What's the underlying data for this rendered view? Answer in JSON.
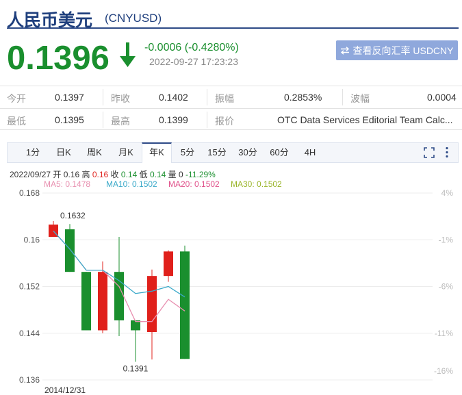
{
  "header": {
    "title": "人民币美元",
    "code": "(CNYUSD)"
  },
  "quote": {
    "price": "0.1396",
    "change": "-0.0006 (-0.4280%)",
    "time": "2022-09-27 17:23:23",
    "switch_label": "查看反向汇率 USDCNY",
    "colors": {
      "down": "#1a8f2e",
      "up": "#e0201b",
      "accent": "#2d4a86"
    }
  },
  "stats": [
    [
      {
        "label": "今开",
        "value": "0.1397"
      },
      {
        "label": "昨收",
        "value": "0.1402"
      },
      {
        "label": "振幅",
        "value": "0.2853%"
      },
      {
        "label": "波幅",
        "value": "0.0004"
      }
    ],
    [
      {
        "label": "最低",
        "value": "0.1395"
      },
      {
        "label": "最高",
        "value": "0.1399"
      },
      {
        "label": "报价",
        "value": "OTC Data Services Editorial Team Calc..."
      }
    ]
  ],
  "tabs": [
    "1分",
    "日K",
    "周K",
    "月K",
    "年K",
    "5分",
    "15分",
    "30分",
    "60分",
    "4H"
  ],
  "active_tab": "年K",
  "candle_info": {
    "date": "2022/09/27",
    "open_label": "开",
    "open": "0.16",
    "high_label": "高",
    "high": "0.16",
    "close_label": "收",
    "close": "0.14",
    "low_label": "低",
    "low": "0.14",
    "vol_label": "量",
    "vol": "0",
    "change": "-11.29%"
  },
  "ma": [
    {
      "label": "MA5: 0.1478",
      "color": "#e890b0"
    },
    {
      "label": "MA10: 0.1502",
      "color": "#3aa9c9"
    },
    {
      "label": "MA20: 0.1502",
      "color": "#e0508a"
    },
    {
      "label": "MA30: 0.1502",
      "color": "#9ab52a"
    }
  ],
  "chart_data": {
    "type": "candlestick",
    "ylim": [
      0.136,
      0.168
    ],
    "y_ticks": [
      "0.168",
      "0.16",
      "0.152",
      "0.144",
      "0.136"
    ],
    "y_tick_values": [
      0.168,
      0.16,
      0.152,
      0.144,
      0.136
    ],
    "right_ticks": [
      "4%",
      "-1%",
      "-6%",
      "-11%",
      "-16%"
    ],
    "right_tick_values": [
      0.168,
      0.16,
      0.152,
      0.144,
      0.1375
    ],
    "x_label": "2014/12/31",
    "grid": true,
    "candles": [
      {
        "open": 0.1605,
        "close": 0.1626,
        "high": 0.1632,
        "low": 0.1605
      },
      {
        "open": 0.1618,
        "close": 0.1545,
        "high": 0.1627,
        "low": 0.1545
      },
      {
        "open": 0.1545,
        "close": 0.1445,
        "high": 0.1545,
        "low": 0.1445
      },
      {
        "open": 0.1445,
        "close": 0.1545,
        "high": 0.1563,
        "low": 0.144
      },
      {
        "open": 0.1545,
        "close": 0.1462,
        "high": 0.1605,
        "low": 0.1435
      },
      {
        "open": 0.1462,
        "close": 0.1445,
        "high": 0.1462,
        "low": 0.1391
      },
      {
        "open": 0.1442,
        "close": 0.1538,
        "high": 0.1549,
        "low": 0.1395
      },
      {
        "open": 0.1538,
        "close": 0.158,
        "high": 0.1582,
        "low": 0.1528
      },
      {
        "open": 0.158,
        "close": 0.1396,
        "high": 0.159,
        "low": 0.1396
      }
    ],
    "ma_series": [
      {
        "name": "MA5",
        "color": "#e890b0",
        "values": [
          0.1615,
          0.1584,
          0.1548,
          0.1548,
          0.152,
          0.146,
          0.146,
          0.1498,
          0.1478
        ]
      },
      {
        "name": "MA10",
        "color": "#3aa9c9",
        "values": [
          0.1615,
          0.1584,
          0.1548,
          0.1548,
          0.153,
          0.1508,
          0.1512,
          0.152,
          0.1502
        ]
      }
    ],
    "annotations": [
      {
        "text": "0.1632",
        "value": 0.1632,
        "candle": 0
      },
      {
        "text": "0.1391",
        "value": 0.1391,
        "candle": 5
      }
    ]
  }
}
